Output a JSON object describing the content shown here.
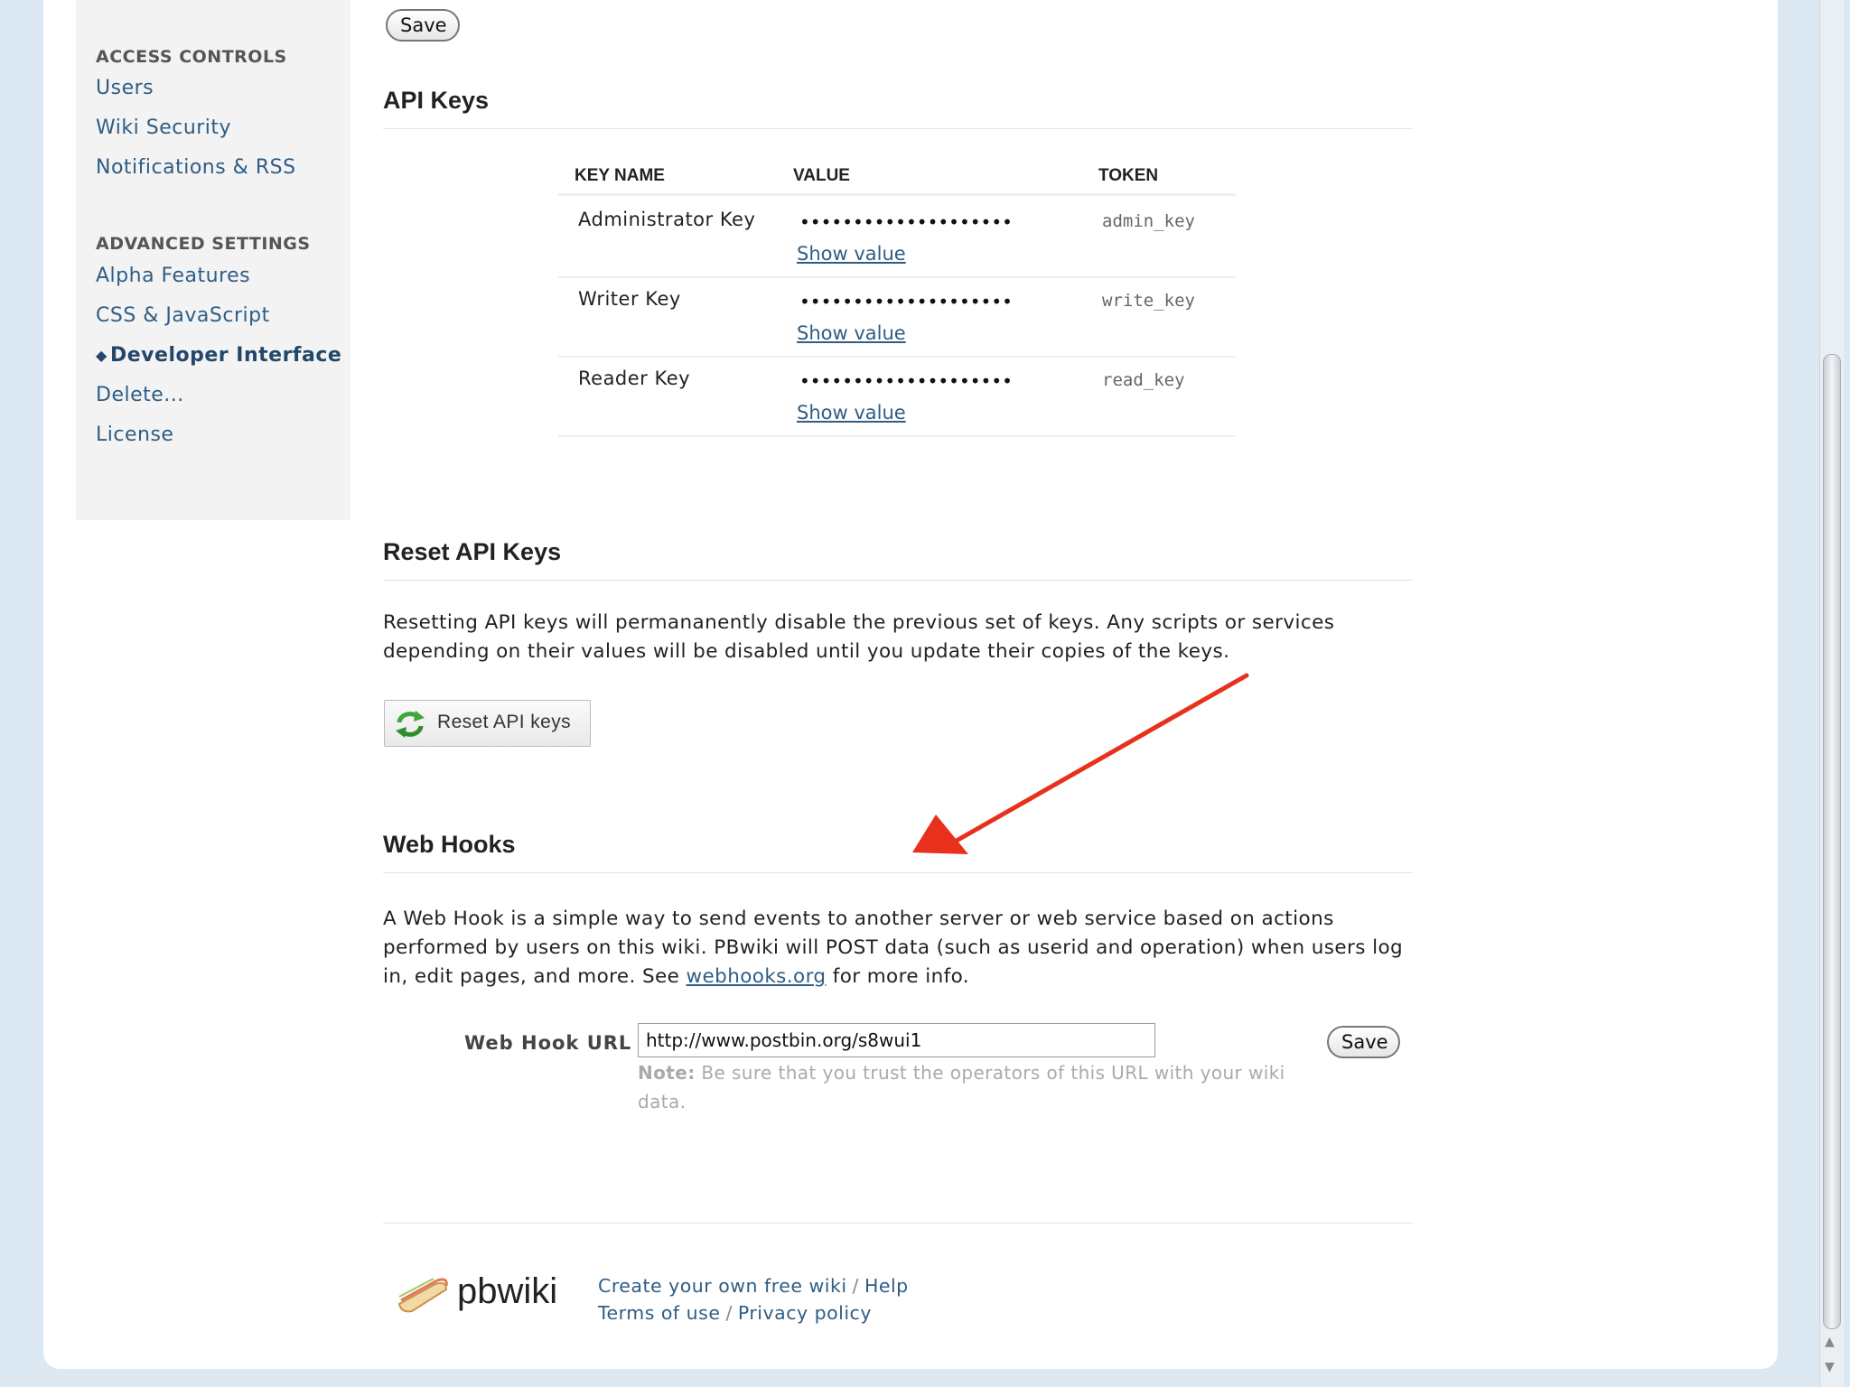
{
  "sidebar": {
    "access_heading": "ACCESS CONTROLS",
    "access_items": [
      {
        "label": "Users"
      },
      {
        "label": "Wiki Security"
      },
      {
        "label": "Notifications & RSS"
      }
    ],
    "advanced_heading": "ADVANCED SETTINGS",
    "advanced_items": [
      {
        "label": "Alpha Features"
      },
      {
        "label": "CSS & JavaScript"
      },
      {
        "label": "Developer Interface",
        "active": true
      },
      {
        "label": "Delete..."
      },
      {
        "label": "License"
      }
    ]
  },
  "top_save_label": "Save",
  "api_keys": {
    "title": "API Keys",
    "columns": [
      "KEY NAME",
      "VALUE",
      "TOKEN"
    ],
    "rows": [
      {
        "name": "Administrator Key",
        "value": "••••••••••••••••••••",
        "show": "Show value",
        "token": "admin_key"
      },
      {
        "name": "Writer Key",
        "value": "••••••••••••••••••••",
        "show": "Show value",
        "token": "write_key"
      },
      {
        "name": "Reader Key",
        "value": "••••••••••••••••••••",
        "show": "Show value",
        "token": "read_key"
      }
    ]
  },
  "reset": {
    "title": "Reset API Keys",
    "text": "Resetting API keys will permananently disable the previous set of keys. Any scripts or services depending on their values will be disabled until you update their copies of the keys.",
    "button_label": "Reset API keys"
  },
  "webhooks": {
    "title": "Web Hooks",
    "text_before": "A Web Hook is a simple way to send events to another server or web service based on actions performed by users on this wiki. PBwiki will POST data (such as userid and operation) when users log in, edit pages, and more. See ",
    "link": "webhooks.org",
    "text_after": " for more info.",
    "url_label": "Web Hook URL",
    "url_value": "http://www.postbin.org/s8wui1",
    "note_label": "Note:",
    "note_text": " Be sure that you trust the operators of this URL with your wiki data.",
    "save_label": "Save"
  },
  "footer": {
    "logo": "pbwiki",
    "create": "Create your own free wiki",
    "help": "Help",
    "terms": "Terms of use",
    "privacy": "Privacy policy",
    "separator": "/"
  },
  "colors": {
    "link": "#2f5d84",
    "annotation_arrow": "#e8301c",
    "page_bg": "#dce8f2"
  }
}
